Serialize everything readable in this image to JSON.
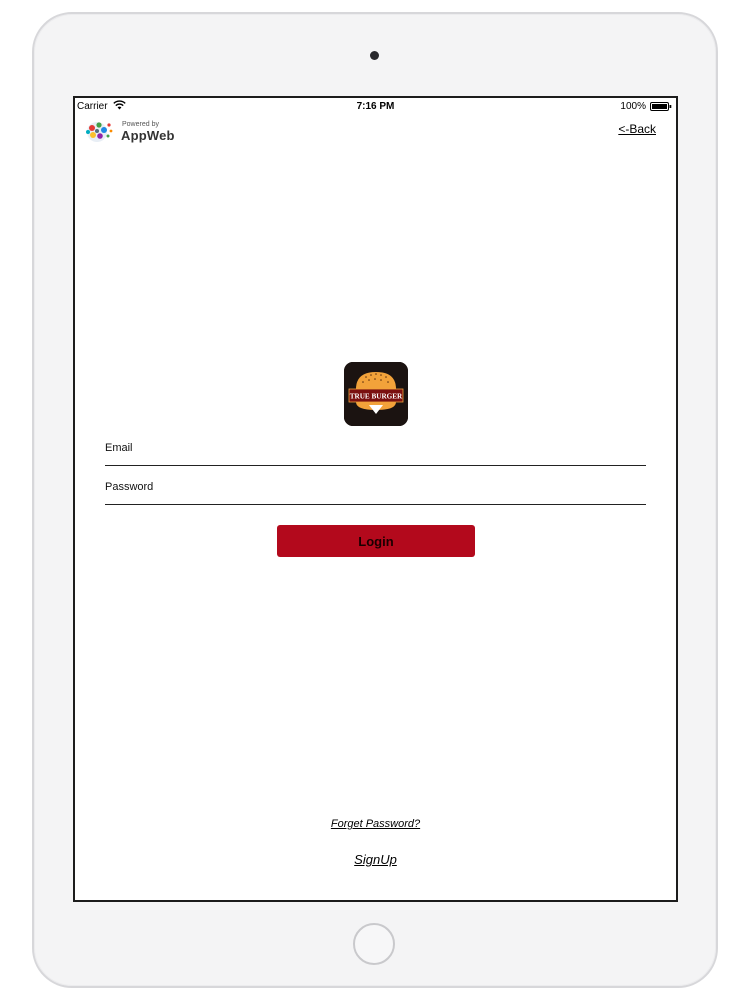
{
  "status_bar": {
    "carrier": "Carrier",
    "time": "7:16 PM",
    "battery": "100%"
  },
  "header": {
    "powered_by": "Powered by",
    "brand_name": "AppWeb",
    "back_label": "<-Back"
  },
  "logo": {
    "text": "TRUE BURGER",
    "icon": "burger-icon"
  },
  "form": {
    "email_placeholder": "Email",
    "password_placeholder": "Password",
    "login_label": "Login"
  },
  "footer": {
    "forgot_label": "Forget Password?",
    "signup_label": "SignUp"
  },
  "colors": {
    "accent": "#b3091c",
    "logo_background": "#1b1311",
    "burger_bun": "#f2a23a"
  }
}
